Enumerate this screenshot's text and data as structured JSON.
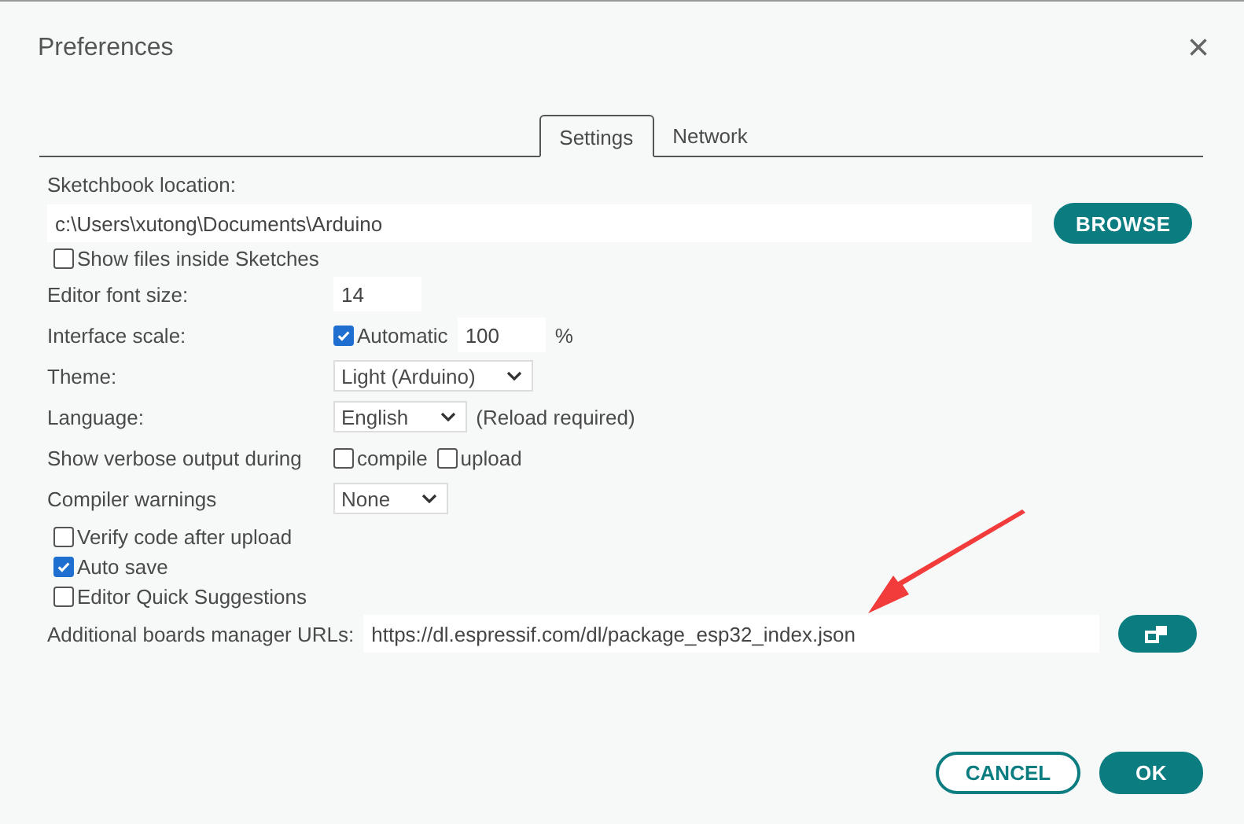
{
  "window": {
    "title": "Preferences",
    "close": "×"
  },
  "tabs": [
    {
      "label": "Settings",
      "selected": true
    },
    {
      "label": "Network",
      "selected": false
    }
  ],
  "sketchbook": {
    "label": "Sketchbook location:",
    "value": "c:\\Users\\xutong\\Documents\\Arduino",
    "button": "BROWSE",
    "show_files": {
      "label": "Show files inside Sketches",
      "checked": false
    }
  },
  "rows": [
    {
      "kind": "input",
      "label": "Editor font size:",
      "value": "14"
    },
    {
      "kind": "scale",
      "label": "Interface scale:",
      "checkbox": {
        "label": "Automatic",
        "checked": true
      },
      "value": "100",
      "unit": "%"
    },
    {
      "kind": "select",
      "label": "Theme:",
      "value": "Light (Arduino)"
    },
    {
      "kind": "select",
      "label": "Language:",
      "value": "English",
      "note": "(Reload required)"
    },
    {
      "kind": "checks",
      "label": "Show verbose output during",
      "checks": [
        {
          "label": "compile",
          "checked": false
        },
        {
          "label": "upload",
          "checked": false
        }
      ]
    },
    {
      "kind": "select",
      "label": "Compiler warnings",
      "value": "None"
    }
  ],
  "options": [
    {
      "label": "Verify code after upload",
      "checked": false
    },
    {
      "label": "Auto save",
      "checked": true
    },
    {
      "label": "Editor Quick Suggestions",
      "checked": false
    }
  ],
  "boards_urls": {
    "label": "Additional boards manager URLs:",
    "value": "https://dl.espressif.com/dl/package_esp32_index.json"
  },
  "buttons": [
    {
      "label": "CANCEL",
      "kind": "secondary"
    },
    {
      "label": "OK",
      "kind": "primary"
    }
  ]
}
